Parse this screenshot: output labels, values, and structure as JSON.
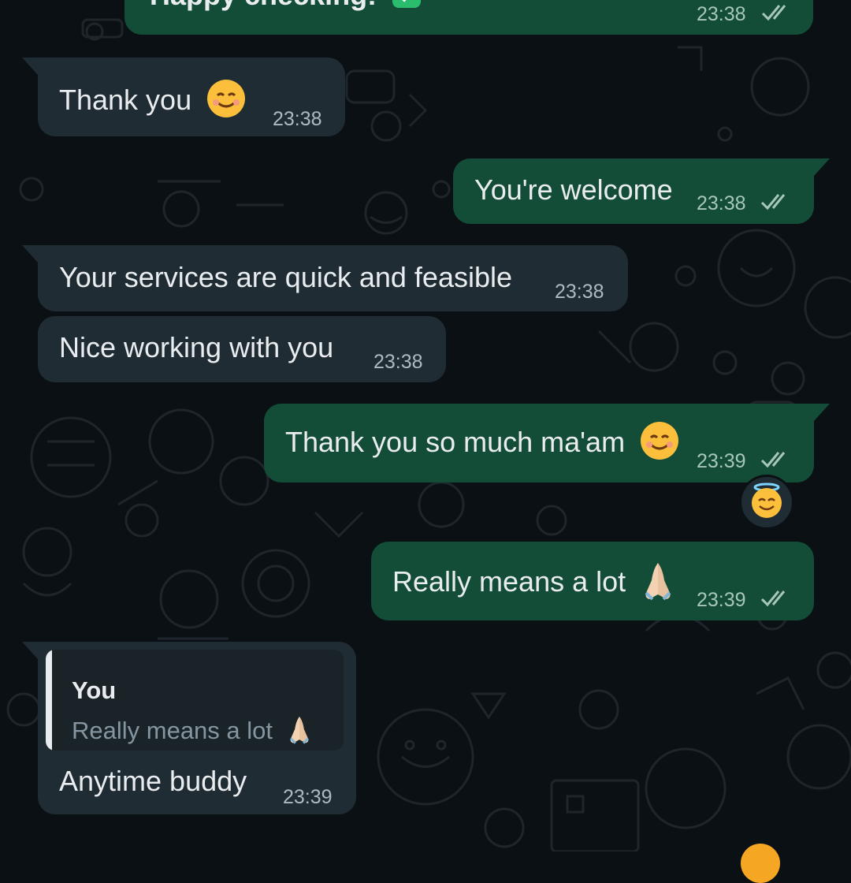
{
  "colors": {
    "background": "#0b1014",
    "incoming_bubble": "#202c33",
    "outgoing_bubble": "#144d37",
    "text": "#e9edef",
    "timestamp": "#aebac1",
    "read_ticks": "#a7c7b8"
  },
  "messages": [
    {
      "direction": "outgoing",
      "text": "Happy checking!",
      "time": "23:38",
      "status": "read",
      "emoji": "check-mark-icon"
    },
    {
      "direction": "incoming",
      "text": "Thank you",
      "time": "23:38",
      "emoji": "smiling-face-icon"
    },
    {
      "direction": "outgoing",
      "text": "You're welcome",
      "time": "23:38",
      "status": "read"
    },
    {
      "direction": "incoming",
      "text": "Your services are quick and feasible",
      "time": "23:38"
    },
    {
      "direction": "incoming",
      "text": "Nice working with you",
      "time": "23:38"
    },
    {
      "direction": "outgoing",
      "text": "Thank you so much ma'am",
      "time": "23:39",
      "status": "read",
      "emoji": "smiling-face-icon",
      "reaction": "halo-face-icon"
    },
    {
      "direction": "outgoing",
      "text": "Really means a lot",
      "time": "23:39",
      "status": "read",
      "emoji": "folded-hands-icon"
    },
    {
      "direction": "incoming",
      "text": "Anytime buddy",
      "time": "23:39",
      "quoted": {
        "author": "You",
        "text": "Really means a lot",
        "emoji": "folded-hands-icon"
      }
    }
  ]
}
